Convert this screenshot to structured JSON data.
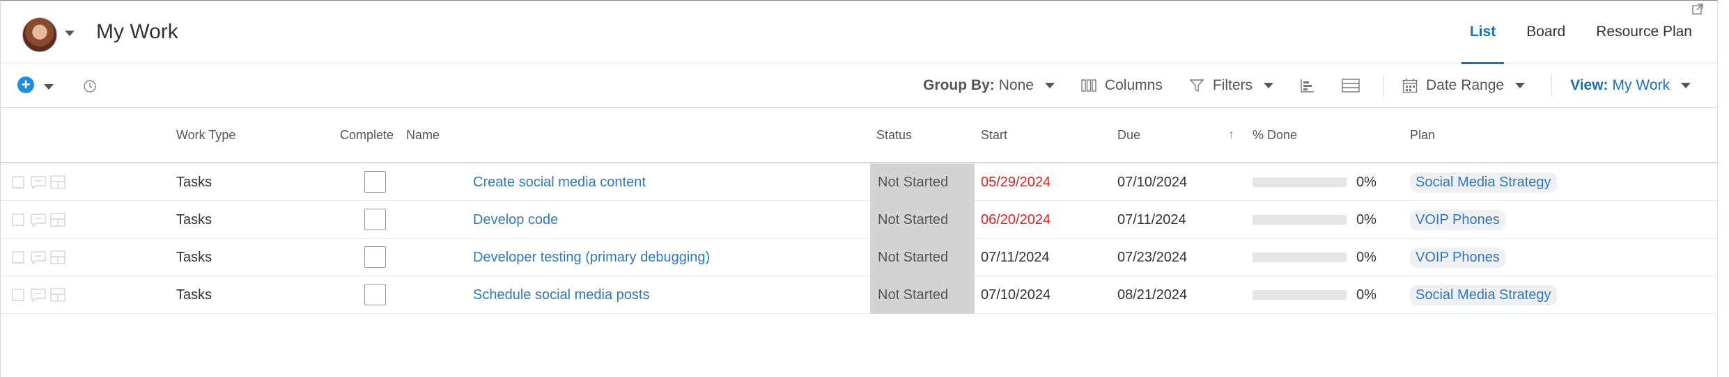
{
  "header": {
    "title": "My Work",
    "tabs": [
      {
        "label": "List",
        "active": true
      },
      {
        "label": "Board",
        "active": false
      },
      {
        "label": "Resource Plan",
        "active": false
      }
    ]
  },
  "toolbar": {
    "add_icon": "plus-circle-icon",
    "group_by_label": "Group By:",
    "group_by_value": "None",
    "columns_label": "Columns",
    "filters_label": "Filters",
    "date_range_label": "Date Range",
    "view_label": "View:",
    "view_value": "My Work"
  },
  "table": {
    "columns": {
      "work_type": "Work Type",
      "complete": "Complete",
      "name": "Name",
      "status": "Status",
      "start": "Start",
      "due": "Due",
      "done": "% Done",
      "plan": "Plan"
    },
    "rows": [
      {
        "work_type": "Tasks",
        "name": "Create social media content",
        "status": "Not Started",
        "start": "05/29/2024",
        "start_overdue": true,
        "due": "07/10/2024",
        "done": "0%",
        "done_fraction": 0,
        "plan": "Social Media Strategy"
      },
      {
        "work_type": "Tasks",
        "name": "Develop code",
        "status": "Not Started",
        "start": "06/20/2024",
        "start_overdue": true,
        "due": "07/11/2024",
        "done": "0%",
        "done_fraction": 0,
        "plan": "VOIP Phones"
      },
      {
        "work_type": "Tasks",
        "name": "Developer testing (primary debugging)",
        "status": "Not Started",
        "start": "07/11/2024",
        "start_overdue": false,
        "due": "07/23/2024",
        "done": "0%",
        "done_fraction": 0,
        "plan": "VOIP Phones"
      },
      {
        "work_type": "Tasks",
        "name": "Schedule social media posts",
        "status": "Not Started",
        "start": "07/10/2024",
        "start_overdue": false,
        "due": "08/21/2024",
        "done": "0%",
        "done_fraction": 0,
        "plan": "Social Media Strategy"
      }
    ]
  },
  "colors": {
    "accent": "#1a6fb5",
    "overdue": "#e02020",
    "status_bg": "#d3d3d3"
  }
}
